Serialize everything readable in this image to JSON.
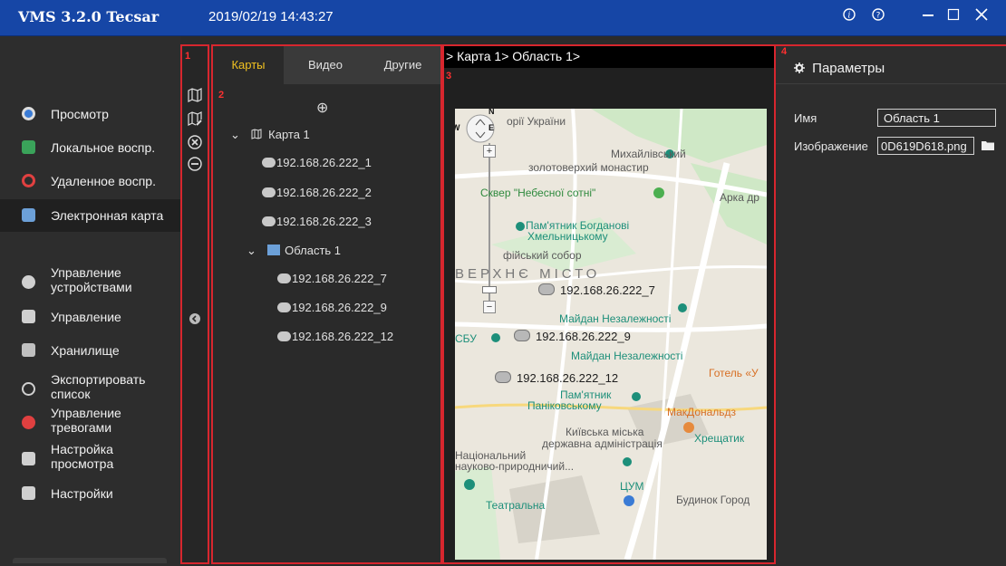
{
  "titlebar": {
    "app_title": "VMS 3.2.0 Tecsar",
    "datetime": "2019/02/19 14:43:27",
    "buttons": [
      "info",
      "help",
      "minimize",
      "maximize",
      "close"
    ]
  },
  "nav": {
    "items": [
      {
        "id": "preview",
        "label": "Просмотр",
        "icon": "preview-icon",
        "color": "#3a7bd5"
      },
      {
        "id": "local-playback",
        "label": "Локальное воспр.",
        "icon": "local-playback-icon",
        "color": "#3aa35a"
      },
      {
        "id": "remote-playback",
        "label": "Удаленное воспр.",
        "icon": "remote-playback-icon",
        "color": "#e04040"
      },
      {
        "id": "emap",
        "label": "Электронная карта",
        "icon": "map-icon",
        "color": "#6ca0d8",
        "active": true
      },
      {
        "id": "device-mgmt",
        "label": "Управление\nустройствами",
        "icon": "device-icon",
        "color": "#d0d0d0"
      },
      {
        "id": "management",
        "label": "Управление",
        "icon": "user-icon",
        "color": "#d0d0d0"
      },
      {
        "id": "storage",
        "label": "Хранилище",
        "icon": "storage-icon",
        "color": "#d0d0d0"
      },
      {
        "id": "export-list",
        "label": "Экспортировать\nсписок",
        "icon": "export-icon",
        "color": "#d0d0d0"
      },
      {
        "id": "alarm-mgmt",
        "label": "Управление\nтревогами",
        "icon": "alarm-icon",
        "color": "#e04040"
      },
      {
        "id": "view-setup",
        "label": "Настройка\nпросмотра",
        "icon": "layout-icon",
        "color": "#d0d0d0"
      },
      {
        "id": "settings",
        "label": "Настройки",
        "icon": "settings-icon",
        "color": "#d0d0d0"
      }
    ]
  },
  "markers": {
    "m1": "1",
    "m2": "2",
    "m3": "3",
    "m4": "4"
  },
  "toolbar": {
    "icons": [
      "add-map-icon",
      "edit-map-icon",
      "delete-icon",
      "remove-icon"
    ],
    "collapse": "collapse-left-icon"
  },
  "tree": {
    "tabs": [
      {
        "label": "Карты",
        "active": true
      },
      {
        "label": "Видео"
      },
      {
        "label": "Другие"
      }
    ],
    "add_button": "⊕",
    "map_node": {
      "label": "Карта 1"
    },
    "cameras_map": [
      "192.168.26.222_1",
      "192.168.26.222_2",
      "192.168.26.222_3"
    ],
    "area_node": {
      "label": "Область 1"
    },
    "cameras_area": [
      "192.168.26.222_7",
      "192.168.26.222_9",
      "192.168.26.222_12"
    ]
  },
  "map": {
    "breadcrumb": "> Карта 1> Область 1>",
    "compass": {
      "n": "N",
      "w": "W",
      "e": "E"
    },
    "labels": [
      {
        "text": "орії України",
        "cls": ""
      },
      {
        "text": "Михайлівський",
        "cls": ""
      },
      {
        "text": "золотоверхий монастир",
        "cls": ""
      },
      {
        "text": "Сквер \"Небесної сотні\"",
        "cls": "green"
      },
      {
        "text": "Арка др",
        "cls": ""
      },
      {
        "text": "Пам'ятник Богданові",
        "cls": "teal"
      },
      {
        "text": "Хмельницькому",
        "cls": "teal"
      },
      {
        "text": "фійський собор",
        "cls": ""
      },
      {
        "text": "ВЕРХНЄ МІСТО",
        "cls": "big"
      },
      {
        "text": "Майдан Незалежності",
        "cls": "teal"
      },
      {
        "text": "СБУ",
        "cls": "teal"
      },
      {
        "text": "Майдан Незалежності",
        "cls": "teal"
      },
      {
        "text": "Готель «У",
        "cls": "orange"
      },
      {
        "text": "Пам'ятник",
        "cls": "teal"
      },
      {
        "text": "Паніковському",
        "cls": "teal"
      },
      {
        "text": "МакДональдз",
        "cls": "orange"
      },
      {
        "text": "Київська міська",
        "cls": ""
      },
      {
        "text": "державна адміністрація",
        "cls": ""
      },
      {
        "text": "Хрещатик",
        "cls": "teal"
      },
      {
        "text": "Національний",
        "cls": ""
      },
      {
        "text": "науково-природничий...",
        "cls": ""
      },
      {
        "text": "ЦУМ",
        "cls": "teal"
      },
      {
        "text": "Театральна",
        "cls": "teal"
      },
      {
        "text": "Будинок Город",
        "cls": ""
      }
    ],
    "cameras": [
      "192.168.26.222_7",
      "192.168.26.222_9",
      "192.168.26.222_12"
    ]
  },
  "params": {
    "title": "Параметры",
    "name_label": "Имя",
    "name_value": "Область 1",
    "image_label": "Изображение",
    "image_value": "0D619D618.png"
  }
}
